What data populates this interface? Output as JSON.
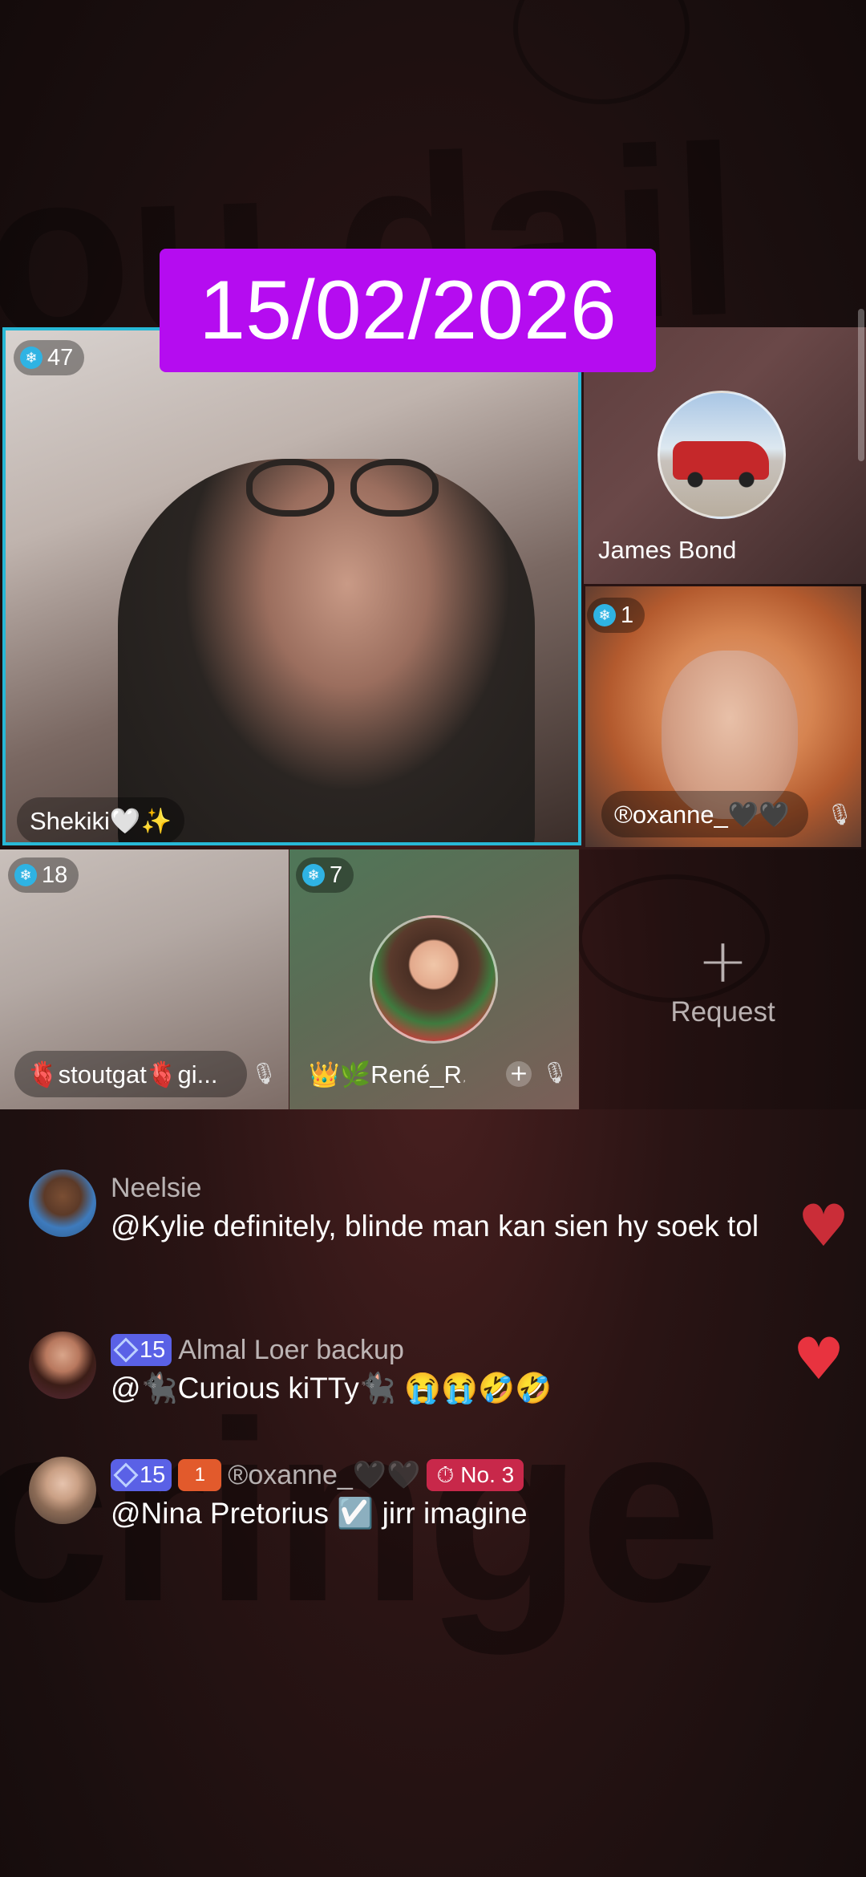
{
  "date_banner": "15/02/2026",
  "background_words": {
    "top": "ou dail",
    "bottom": "cringe"
  },
  "tiles": {
    "main": {
      "score": "47",
      "name": "Shekiki🤍✨"
    },
    "james": {
      "name": "James Bond"
    },
    "oxanne": {
      "score": "1",
      "name": "®oxanne_🖤🖤"
    },
    "stout": {
      "score": "18",
      "name": "🫀stoutgat🫀gi..."
    },
    "rene": {
      "score": "7",
      "name": "👑🌿René_R..."
    },
    "request": {
      "plus": "+",
      "label": "Request"
    }
  },
  "comments": [
    {
      "user": "Neelsie",
      "text": "@Kylie definitely, blinde man kan sien hy soek tol",
      "liked": true
    },
    {
      "level": "15",
      "user": "Almal  Loer backup",
      "text": "@🐈‍⬛Curious kiTTy🐈‍⬛ 😭😭🤣🤣",
      "liked": true
    },
    {
      "level": "15",
      "fan_icon": "1",
      "user": "®oxanne_🖤🖤",
      "rank": "No. 3",
      "text": "@Nina Pretorius ☑️ jirr imagine",
      "liked": false
    }
  ],
  "colors": {
    "banner": "#b50cf0",
    "active_border": "#28b8d6",
    "heart": "#e8333f",
    "level_badge": "#5a61e6"
  },
  "icons": [
    "gem-icon",
    "mic-off-icon",
    "add-icon",
    "plus-icon",
    "heart-icon",
    "diamond-icon",
    "stopwatch-icon"
  ]
}
